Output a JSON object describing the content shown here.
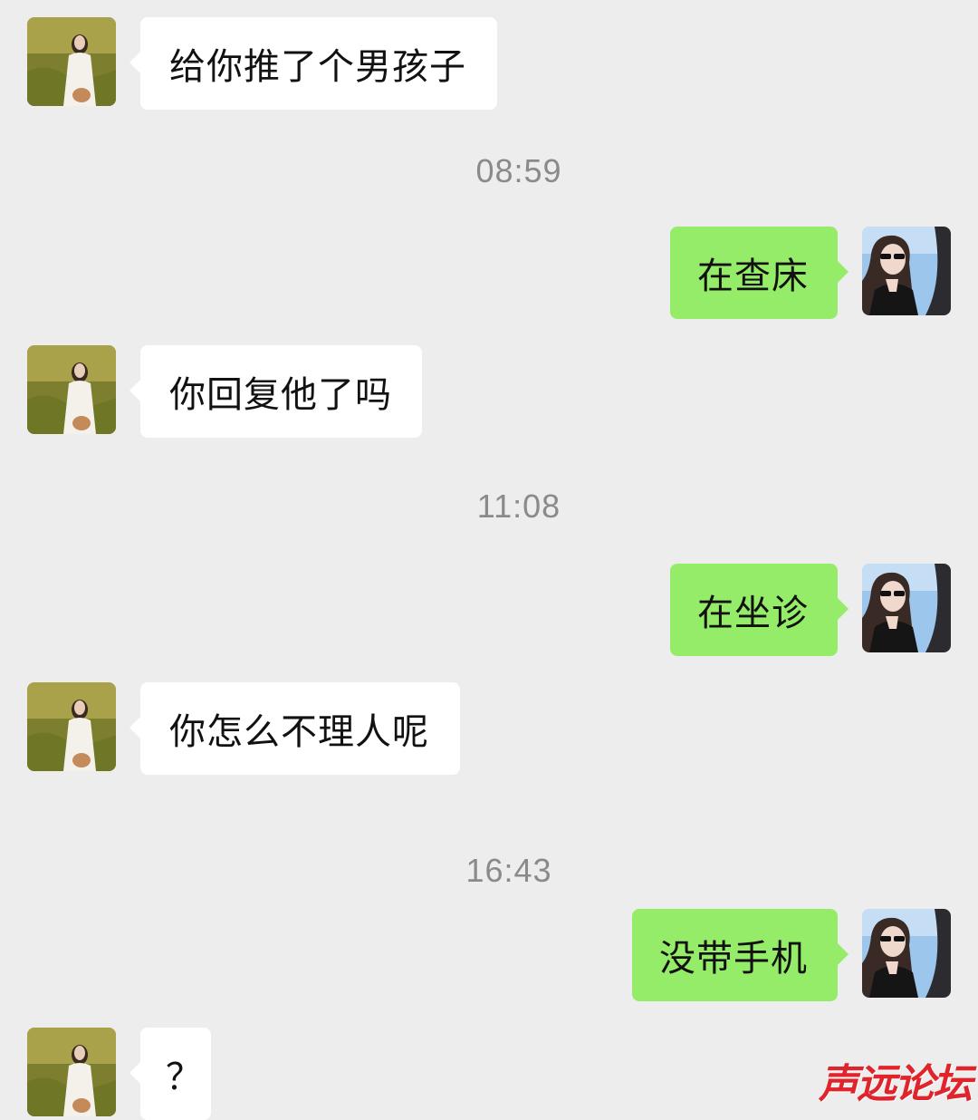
{
  "chat": {
    "messages": [
      {
        "side": "in",
        "text": "给你推了个男孩子"
      },
      {
        "side": "time",
        "text": "08:59"
      },
      {
        "side": "out",
        "text": "在查床"
      },
      {
        "side": "in",
        "text": "你回复他了吗"
      },
      {
        "side": "time",
        "text": "11:08"
      },
      {
        "side": "out",
        "text": "在坐诊"
      },
      {
        "side": "in",
        "text": "你怎么不理人呢"
      },
      {
        "side": "time",
        "text": "16:43"
      },
      {
        "side": "out",
        "text": "没带手机"
      },
      {
        "side": "in",
        "text": "？"
      }
    ]
  },
  "watermark": "声远论坛",
  "colors": {
    "background": "#ededed",
    "incoming_bubble": "#ffffff",
    "outgoing_bubble": "#95ec69",
    "timestamp": "#8a8a8a",
    "watermark": "#e0242c"
  },
  "icons": {
    "incoming_avatar": "woman-in-field-avatar",
    "outgoing_avatar": "woman-in-sunglasses-avatar"
  }
}
